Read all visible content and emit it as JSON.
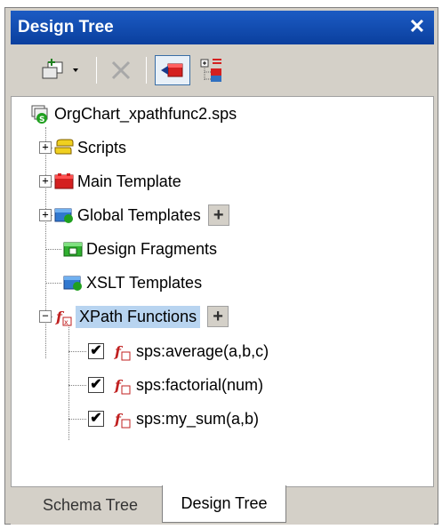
{
  "window": {
    "title": "Design Tree",
    "close_icon": "close-icon"
  },
  "toolbar": {
    "buttons": [
      {
        "name": "add-new-item-button",
        "icon": "add-item-icon",
        "has_dropdown": true
      },
      {
        "name": "delete-button",
        "icon": "delete-x-icon"
      },
      {
        "name": "show-only-used-button",
        "icon": "red-template-arrow-icon",
        "pressed": true
      },
      {
        "name": "expand-all-button",
        "icon": "expand-tree-icon"
      }
    ]
  },
  "tree": {
    "root": {
      "label": "OrgChart_xpathfunc2.sps",
      "icon": "sps-file-icon"
    },
    "items": [
      {
        "label": "Scripts",
        "icon": "scripts-icon",
        "expander": "+"
      },
      {
        "label": "Main Template",
        "icon": "main-template-icon",
        "expander": "+"
      },
      {
        "label": "Global Templates",
        "icon": "global-templates-icon",
        "expander": "+",
        "add_button": "+"
      },
      {
        "label": "Design Fragments",
        "icon": "design-fragments-icon"
      },
      {
        "label": "XSLT Templates",
        "icon": "xslt-templates-icon"
      },
      {
        "label": "XPath Functions",
        "icon": "xpath-functions-icon",
        "expander": "−",
        "add_button": "+",
        "selected": true
      }
    ],
    "functions": [
      {
        "label": "sps:average(a,b,c)",
        "checked": "✔"
      },
      {
        "label": "sps:factorial(num)",
        "checked": "✔"
      },
      {
        "label": "sps:my_sum(a,b)",
        "checked": "✔"
      }
    ]
  },
  "tabs": [
    {
      "label": "Schema Tree",
      "active": false
    },
    {
      "label": "Design Tree",
      "active": true
    }
  ],
  "colors": {
    "titlebar": "#0a3f9e",
    "panel_bg": "#d4d0c8",
    "selection": "#b8d4f0"
  }
}
